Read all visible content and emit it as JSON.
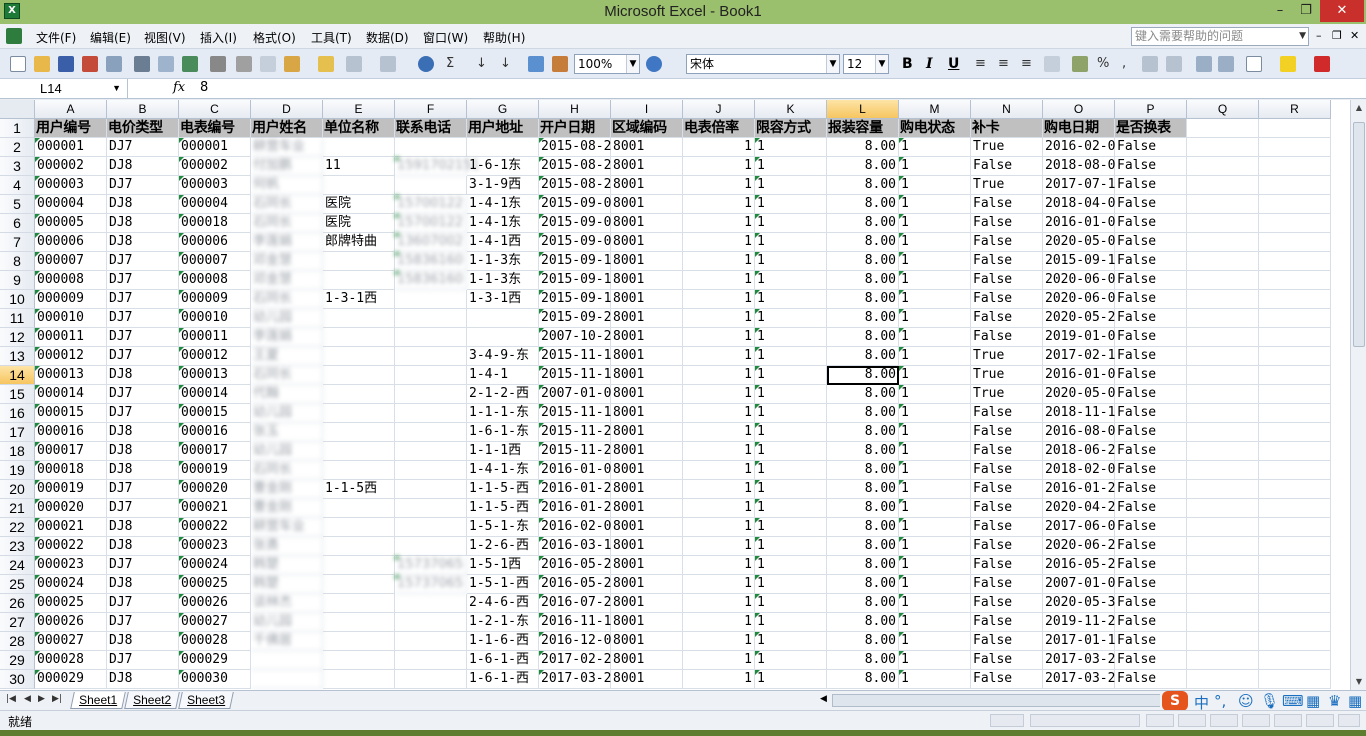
{
  "window": {
    "title": "Microsoft Excel - Book1",
    "app_icon": "excel-icon",
    "min": "–",
    "max": "❐",
    "close": "✕"
  },
  "menu": {
    "items": [
      "文件(F)",
      "编辑(E)",
      "视图(V)",
      "插入(I)",
      "格式(O)",
      "工具(T)",
      "数据(D)",
      "窗口(W)",
      "帮助(H)"
    ],
    "help_placeholder": "键入需要帮助的问题",
    "mdi_min": "–",
    "mdi_restore": "❐",
    "mdi_close": "✕"
  },
  "toolbar": {
    "zoom": "100%",
    "font": "宋体",
    "font_size": "12",
    "bold": "B",
    "italic": "I",
    "underline": "U",
    "percent": "%",
    "comma": ","
  },
  "formula": {
    "name_box": "L14",
    "fx": "fx",
    "value": "8"
  },
  "columns": [
    "A",
    "B",
    "C",
    "D",
    "E",
    "F",
    "G",
    "H",
    "I",
    "J",
    "K",
    "L",
    "M",
    "N",
    "O",
    "P",
    "Q",
    "R"
  ],
  "selected_col": "L",
  "selected_row": 14,
  "header_row": [
    "用户编号",
    "电价类型",
    "电表编号",
    "用户姓名",
    "单位名称",
    "联系电话",
    "用户地址",
    "开户日期",
    "区域编码",
    "电表倍率",
    "限容方式",
    "报装容量",
    "购电状态",
    "补卡",
    "购电日期",
    "是否换表"
  ],
  "rows": [
    [
      "000001",
      "DJ7",
      "000001",
      "耕营车业",
      "",
      "",
      "",
      "2015-08-2",
      "8001",
      "1",
      "1",
      "8.00",
      "1",
      "True",
      "2016-02-0",
      "False"
    ],
    [
      "000002",
      "DJ8",
      "000002",
      "付加鹏",
      "11",
      "1591702151",
      "1-6-1东",
      "2015-08-2",
      "8001",
      "1",
      "1",
      "8.00",
      "1",
      "False",
      "2018-08-0",
      "False"
    ],
    [
      "000003",
      "DJ7",
      "000003",
      "何帆",
      "",
      "",
      "3-1-9西",
      "2015-08-2",
      "8001",
      "1",
      "1",
      "8.00",
      "1",
      "True",
      "2017-07-1",
      "False"
    ],
    [
      "000004",
      "DJ8",
      "000004",
      "石同长",
      "医院",
      "15700122",
      "1-4-1东",
      "2015-09-0",
      "8001",
      "1",
      "1",
      "8.00",
      "1",
      "False",
      "2018-04-0",
      "False"
    ],
    [
      "000005",
      "DJ8",
      "000018",
      "石同长",
      "医院",
      "15700122",
      "1-4-1东",
      "2015-09-0",
      "8001",
      "1",
      "1",
      "8.00",
      "1",
      "False",
      "2016-01-0",
      "False"
    ],
    [
      "000006",
      "DJ8",
      "000006",
      "李莲娟",
      "郎牌特曲",
      "13607002",
      "1-4-1西",
      "2015-09-0",
      "8001",
      "1",
      "1",
      "8.00",
      "1",
      "False",
      "2020-05-0",
      "False"
    ],
    [
      "000007",
      "DJ7",
      "000007",
      "邓金慧",
      "",
      "15836160",
      "1-1-3东",
      "2015-09-1",
      "8001",
      "1",
      "1",
      "8.00",
      "1",
      "False",
      "2015-09-1",
      "False"
    ],
    [
      "000008",
      "DJ7",
      "000008",
      "邓金慧",
      "",
      "15836160",
      "1-1-3东",
      "2015-09-1",
      "8001",
      "1",
      "1",
      "8.00",
      "1",
      "False",
      "2020-06-0",
      "False"
    ],
    [
      "000009",
      "DJ7",
      "000009",
      "石同长",
      "1-3-1西",
      "",
      "1-3-1西",
      "2015-09-1",
      "8001",
      "1",
      "1",
      "8.00",
      "1",
      "False",
      "2020-06-0",
      "False"
    ],
    [
      "000010",
      "DJ7",
      "000010",
      "幼儿园",
      "",
      "",
      "",
      "2015-09-2",
      "8001",
      "1",
      "1",
      "8.00",
      "1",
      "False",
      "2020-05-2",
      "False"
    ],
    [
      "000011",
      "DJ7",
      "000011",
      "李莲娟",
      "",
      "",
      "",
      "2007-10-2",
      "8001",
      "1",
      "1",
      "8.00",
      "1",
      "False",
      "2019-01-0",
      "False"
    ],
    [
      "000012",
      "DJ7",
      "000012",
      "王夏",
      "",
      "",
      "3-4-9-东",
      "2015-11-1",
      "8001",
      "1",
      "1",
      "8.00",
      "1",
      "True",
      "2017-02-1",
      "False"
    ],
    [
      "000013",
      "DJ8",
      "000013",
      "石同长",
      "",
      "",
      "1-4-1",
      "2015-11-1",
      "8001",
      "1",
      "1",
      "8.00",
      "1",
      "True",
      "2016-01-0",
      "False"
    ],
    [
      "000014",
      "DJ7",
      "000014",
      "代翰",
      "",
      "",
      "2-1-2-西",
      "2007-01-0",
      "8001",
      "1",
      "1",
      "8.00",
      "1",
      "True",
      "2020-05-0",
      "False"
    ],
    [
      "000015",
      "DJ7",
      "000015",
      "幼儿园",
      "",
      "",
      "1-1-1-东",
      "2015-11-1",
      "8001",
      "1",
      "1",
      "8.00",
      "1",
      "False",
      "2018-11-1",
      "False"
    ],
    [
      "000016",
      "DJ8",
      "000016",
      "张玉",
      "",
      "",
      "1-6-1-东",
      "2015-11-2",
      "8001",
      "1",
      "1",
      "8.00",
      "1",
      "False",
      "2016-08-0",
      "False"
    ],
    [
      "000017",
      "DJ8",
      "000017",
      "幼儿园",
      "",
      "",
      "1-1-1西",
      "2015-11-2",
      "8001",
      "1",
      "1",
      "8.00",
      "1",
      "False",
      "2018-06-2",
      "False"
    ],
    [
      "000018",
      "DJ8",
      "000019",
      "石同长",
      "",
      "",
      "1-4-1-东",
      "2016-01-0",
      "8001",
      "1",
      "1",
      "8.00",
      "1",
      "False",
      "2018-02-0",
      "False"
    ],
    [
      "000019",
      "DJ7",
      "000020",
      "曹金刚",
      "1-1-5西",
      "",
      "1-1-5-西",
      "2016-01-2",
      "8001",
      "1",
      "1",
      "8.00",
      "1",
      "False",
      "2016-01-2",
      "False"
    ],
    [
      "000020",
      "DJ7",
      "000021",
      "曹金刚",
      "",
      "",
      "1-1-5-西",
      "2016-01-2",
      "8001",
      "1",
      "1",
      "8.00",
      "1",
      "False",
      "2020-04-2",
      "False"
    ],
    [
      "000021",
      "DJ8",
      "000022",
      "耕营车业",
      "",
      "",
      "1-5-1-东",
      "2016-02-0",
      "8001",
      "1",
      "1",
      "8.00",
      "1",
      "False",
      "2017-06-0",
      "False"
    ],
    [
      "000022",
      "DJ8",
      "000023",
      "张勇",
      "",
      "",
      "1-2-6-西",
      "2016-03-1",
      "8001",
      "1",
      "1",
      "8.00",
      "1",
      "False",
      "2020-06-2",
      "False"
    ],
    [
      "000023",
      "DJ7",
      "000024",
      "韩楚",
      "",
      "15737065",
      "1-5-1西",
      "2016-05-2",
      "8001",
      "1",
      "1",
      "8.00",
      "1",
      "False",
      "2016-05-2",
      "False"
    ],
    [
      "000024",
      "DJ8",
      "000025",
      "韩楚",
      "",
      "15737065",
      "1-5-1-西",
      "2016-05-2",
      "8001",
      "1",
      "1",
      "8.00",
      "1",
      "False",
      "2007-01-0",
      "False"
    ],
    [
      "000025",
      "DJ7",
      "000026",
      "谈林杰",
      "",
      "",
      "2-4-6-西",
      "2016-07-2",
      "8001",
      "1",
      "1",
      "8.00",
      "1",
      "False",
      "2020-05-3",
      "False"
    ],
    [
      "000026",
      "DJ7",
      "000027",
      "幼儿园",
      "",
      "",
      "1-2-1-东",
      "2016-11-1",
      "8001",
      "1",
      "1",
      "8.00",
      "1",
      "False",
      "2019-11-2",
      "False"
    ],
    [
      "000027",
      "DJ8",
      "000028",
      "千佛居",
      "",
      "",
      "1-1-6-西",
      "2016-12-0",
      "8001",
      "1",
      "1",
      "8.00",
      "1",
      "False",
      "2017-01-1",
      "False"
    ],
    [
      "000028",
      "DJ7",
      "000029",
      "",
      "",
      "",
      "1-6-1-西",
      "2017-02-2",
      "8001",
      "1",
      "1",
      "8.00",
      "1",
      "False",
      "2017-03-2",
      "False"
    ],
    [
      "000029",
      "DJ8",
      "000030",
      "",
      "",
      "",
      "1-6-1-西",
      "2017-03-2",
      "8001",
      "1",
      "1",
      "8.00",
      "1",
      "False",
      "2017-03-2",
      "False"
    ]
  ],
  "sheets": [
    "Sheet1",
    "Sheet2",
    "Sheet3"
  ],
  "active_sheet": "Sheet1",
  "status": "就绪",
  "ime": {
    "logo": "S",
    "lang": "中"
  },
  "colors": {
    "title_bar": "#9bc06d",
    "selected_header": "#f6c560",
    "header_fill": "#c0c0c0",
    "error_indicator": "#1e8a3c"
  }
}
